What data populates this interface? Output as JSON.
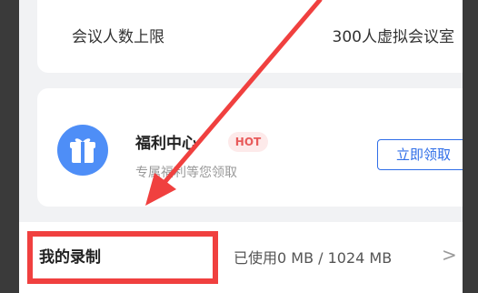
{
  "meeting_limit": {
    "label": "会议人数上限",
    "value": "300人虚拟会议室"
  },
  "benefit": {
    "icon": "gift-icon",
    "title": "福利中心",
    "badge": "HOT",
    "subtitle": "专属福利等您领取",
    "button_label": "立即领取"
  },
  "recording": {
    "label": "我的录制",
    "usage": "已使用0 MB / 1024 MB",
    "chevron": ">"
  },
  "colors": {
    "accent_blue": "#2f6ee8",
    "annotation_red": "#f0403f",
    "hot_red": "#e85a5a"
  }
}
